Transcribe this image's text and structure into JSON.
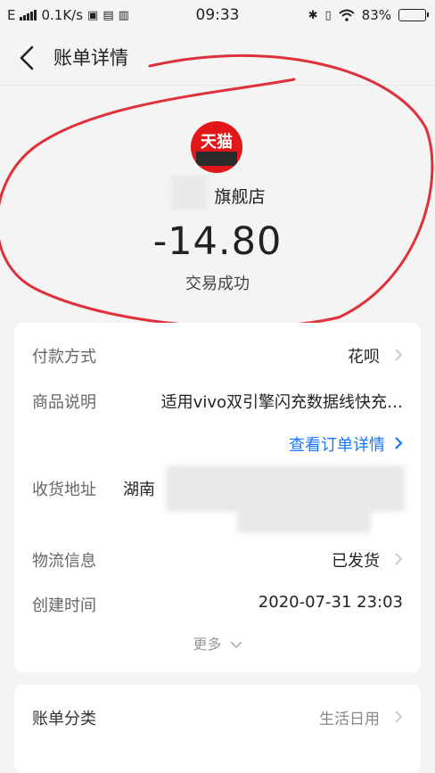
{
  "status_bar": {
    "network": "E",
    "speed": "0.1K/s",
    "time": "09:33",
    "battery": "83%",
    "battery_level": 0.83
  },
  "nav": {
    "title": "账单详情"
  },
  "summary": {
    "logo_text": "天猫",
    "shop_name": "旗舰店",
    "amount": "-14.80",
    "status": "交易成功"
  },
  "details": {
    "payment": {
      "label": "付款方式",
      "value": "花呗"
    },
    "product": {
      "label": "商品说明",
      "value": "适用vivo双引擎闪充数据线快充…"
    },
    "order_link": "查看订单详情",
    "address": {
      "label": "收货地址",
      "value": "湖南"
    },
    "logistics": {
      "label": "物流信息",
      "value": "已发货"
    },
    "created": {
      "label": "创建时间",
      "value": "2020-07-31 23:03"
    },
    "more": "更多"
  },
  "category": {
    "label": "账单分类",
    "value": "生活日用"
  },
  "colors": {
    "accent": "#1677ff",
    "brand": "#e1171a",
    "annotation": "#e0303a"
  }
}
